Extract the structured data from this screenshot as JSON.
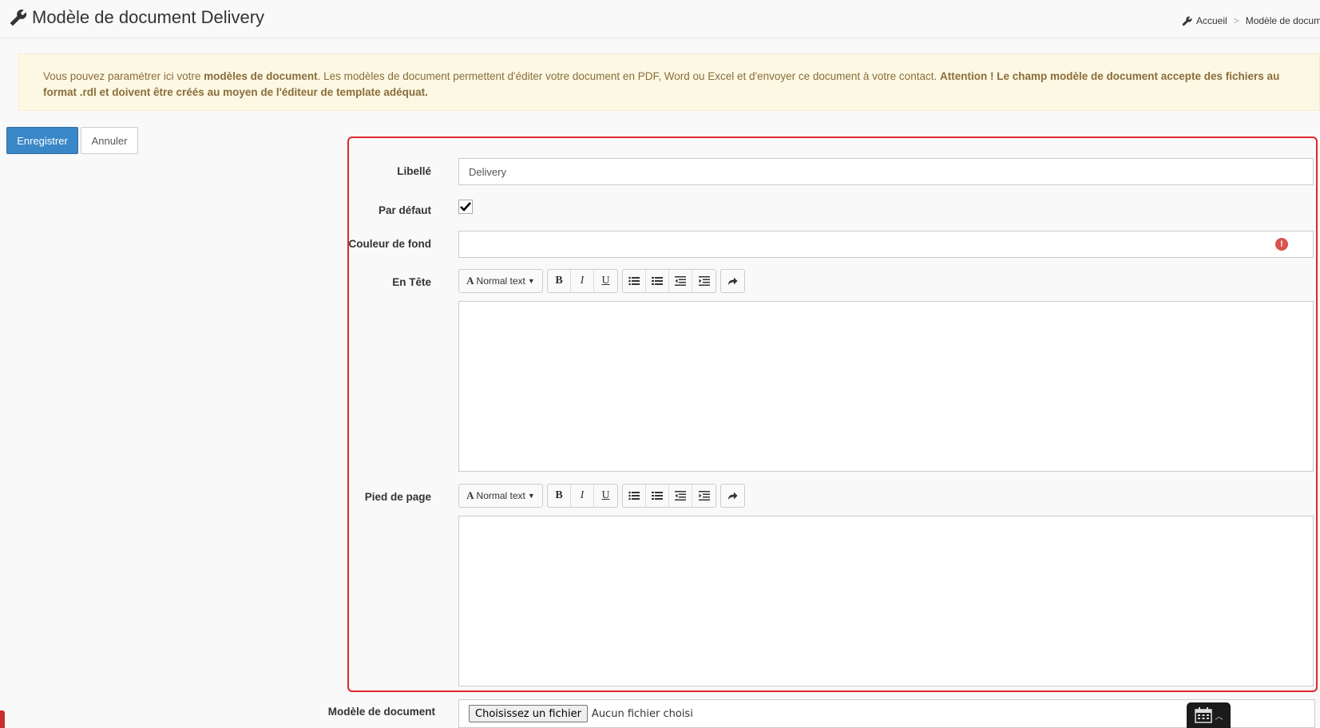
{
  "header": {
    "title": "Modèle de document Delivery",
    "breadcrumb": [
      "Accueil",
      "Modèle de documen"
    ]
  },
  "alert": {
    "part1": "Vous pouvez paramétrer ici votre ",
    "bold1": "modèles de document",
    "part2": ". Les modèles de document permettent d'éditer votre document en PDF, Word ou Excel et d'envoyer ce document à votre contact. ",
    "bold2": "Attention ! Le champ modèle de document accepte des fichiers au format .rdl et doivent être créés au moyen de l'éditeur de template adéquat."
  },
  "actions": {
    "save": "Enregistrer",
    "cancel": "Annuler"
  },
  "form": {
    "libelle": {
      "label": "Libellé",
      "value": "Delivery"
    },
    "par_defaut": {
      "label": "Par défaut",
      "checked": true
    },
    "couleur": {
      "label": "Couleur de fond",
      "value": "",
      "error_icon": "exclamation-circle-icon"
    },
    "en_tete": {
      "label": "En Tête",
      "content": ""
    },
    "pied": {
      "label": "Pied de page",
      "content": ""
    },
    "modele": {
      "label": "Modèle de document",
      "button": "Choisissez un fichier",
      "status": "Aucun fichier choisi"
    }
  },
  "toolbar": {
    "format_label": "Normal text",
    "buttons": [
      "bold",
      "italic",
      "underline",
      "unordered-list",
      "ordered-list",
      "outdent",
      "indent",
      "redo"
    ]
  },
  "colors": {
    "primary": "#3a87c8",
    "alert_bg": "#fcf8e3",
    "alert_text": "#8a6d3b",
    "highlight": "#e0262b",
    "error": "#d9534f"
  }
}
